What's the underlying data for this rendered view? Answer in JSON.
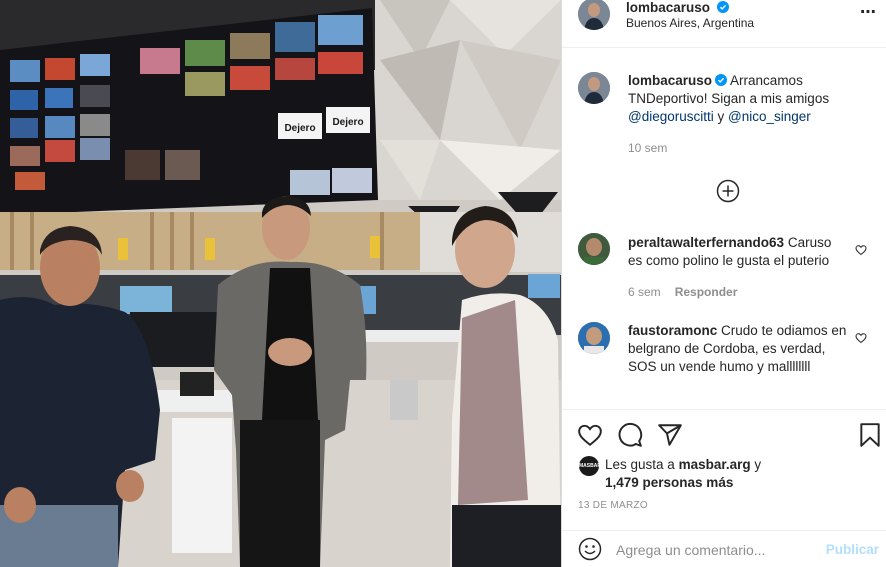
{
  "post": {
    "username": "lombacaruso",
    "location": "Buenos Aires, Argentina",
    "more_icon": "⋯"
  },
  "caption": {
    "username": "lombacaruso",
    "text": "Arrancamos TNDeportivo! Sigan a mis amigos",
    "mention1": "@diegoruscitti",
    "connector": "y",
    "mention2": "@nico_singer",
    "time": "10 sem"
  },
  "comments": [
    {
      "username": "peraltawalterfernando63",
      "text": "Caruso es como polino le gusta el puterio",
      "time": "6 sem",
      "reply": "Responder"
    },
    {
      "username": "faustoramonc",
      "text": "Crudo te odiamos en belgrano de Cordoba, es verdad, SOS un vende humo y mallllllll"
    }
  ],
  "likes": {
    "avatar_text": "MASBAR",
    "prefix": "Les gusta a",
    "user": "masbar.arg",
    "connector": "y",
    "others": "1,479 personas más"
  },
  "date": "13 DE MARZO",
  "composer": {
    "placeholder": "Agrega un comentario...",
    "publish": "Publicar"
  },
  "photo": {
    "monitor_labels": [
      "Dejero",
      "Dejero"
    ]
  },
  "colors": {
    "verified": "#0095f6",
    "mention": "#00376b",
    "muted": "#8e8e8e",
    "publish_disabled": "#b2dffc"
  }
}
